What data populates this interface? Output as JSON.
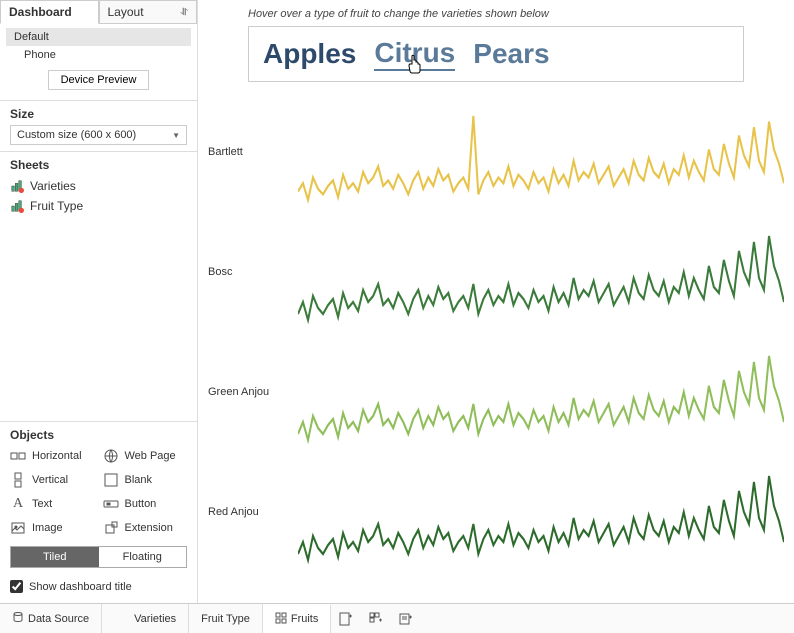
{
  "sidebar": {
    "tabs": {
      "dashboard": "Dashboard",
      "layout": "Layout"
    },
    "devices": {
      "default": "Default",
      "phone": "Phone",
      "preview_btn": "Device Preview"
    },
    "size": {
      "title": "Size",
      "value": "Custom size (600 x 600)"
    },
    "sheets": {
      "title": "Sheets",
      "items": [
        "Varieties",
        "Fruit Type"
      ]
    },
    "objects": {
      "title": "Objects",
      "items": {
        "horizontal": "Horizontal",
        "webpage": "Web Page",
        "vertical": "Vertical",
        "blank": "Blank",
        "text": "Text",
        "button": "Button",
        "image": "Image",
        "extension": "Extension"
      }
    },
    "toggle": {
      "tiled": "Tiled",
      "floating": "Floating"
    },
    "show_title": "Show dashboard title"
  },
  "canvas": {
    "hint": "Hover over a type of fruit to change the varieties shown below",
    "fruits": {
      "apples": "Apples",
      "citrus": "Citrus",
      "pears": "Pears"
    },
    "colors": {
      "apples": "#2d4a6b",
      "citrus": "#5b7a99",
      "pears": "#5b7a99"
    }
  },
  "bottom": {
    "data_source": "Data Source",
    "tabs": [
      "Varieties",
      "Fruit Type",
      "Fruits"
    ]
  },
  "chart_data": [
    {
      "type": "line",
      "label": "Bartlett",
      "color": "#e8c34a",
      "values": [
        45,
        48,
        42,
        50,
        46,
        44,
        47,
        49,
        43,
        51,
        46,
        48,
        45,
        52,
        48,
        50,
        54,
        47,
        49,
        46,
        51,
        48,
        44,
        49,
        52,
        46,
        50,
        47,
        53,
        49,
        51,
        45,
        48,
        50,
        46,
        72,
        44,
        49,
        52,
        47,
        50,
        48,
        54,
        47,
        51,
        49,
        46,
        52,
        48,
        50,
        45,
        53,
        48,
        51,
        47,
        56,
        49,
        52,
        50,
        55,
        48,
        51,
        54,
        47,
        50,
        53,
        48,
        56,
        51,
        49,
        57,
        52,
        50,
        55,
        48,
        53,
        51,
        58,
        50,
        56,
        52,
        49,
        60,
        53,
        51,
        62,
        55,
        50,
        65,
        58,
        54,
        68,
        56,
        52,
        70,
        60,
        55,
        48
      ]
    },
    {
      "type": "line",
      "label": "Bosc",
      "color": "#3a7a3a",
      "values": [
        42,
        46,
        40,
        48,
        44,
        42,
        45,
        47,
        41,
        49,
        44,
        46,
        43,
        50,
        46,
        48,
        52,
        45,
        47,
        44,
        49,
        46,
        42,
        47,
        50,
        44,
        48,
        45,
        51,
        47,
        49,
        43,
        46,
        48,
        44,
        52,
        42,
        47,
        50,
        45,
        48,
        46,
        52,
        45,
        49,
        47,
        44,
        50,
        46,
        48,
        43,
        51,
        46,
        49,
        45,
        54,
        47,
        50,
        48,
        53,
        46,
        49,
        52,
        45,
        48,
        51,
        46,
        54,
        49,
        47,
        55,
        50,
        48,
        53,
        46,
        51,
        49,
        56,
        48,
        54,
        50,
        47,
        58,
        51,
        49,
        60,
        53,
        48,
        63,
        56,
        52,
        66,
        54,
        50,
        68,
        58,
        53,
        46
      ]
    },
    {
      "type": "line",
      "label": "Green Anjou",
      "color": "#8fbe5a",
      "values": [
        40,
        44,
        38,
        46,
        42,
        40,
        43,
        45,
        39,
        47,
        42,
        44,
        41,
        48,
        44,
        46,
        50,
        43,
        45,
        42,
        47,
        44,
        40,
        45,
        48,
        42,
        46,
        43,
        49,
        45,
        47,
        41,
        44,
        46,
        42,
        50,
        40,
        45,
        48,
        43,
        46,
        44,
        50,
        43,
        47,
        45,
        42,
        48,
        44,
        46,
        41,
        49,
        44,
        47,
        43,
        52,
        45,
        48,
        46,
        51,
        44,
        47,
        50,
        43,
        46,
        49,
        44,
        52,
        47,
        45,
        53,
        48,
        46,
        51,
        44,
        49,
        47,
        54,
        46,
        52,
        48,
        45,
        56,
        49,
        47,
        58,
        51,
        46,
        61,
        54,
        50,
        64,
        52,
        48,
        66,
        56,
        51,
        44
      ]
    },
    {
      "type": "line",
      "label": "Red Anjou",
      "color": "#2d6b2d",
      "values": [
        38,
        42,
        36,
        44,
        40,
        38,
        41,
        43,
        37,
        45,
        40,
        42,
        39,
        46,
        42,
        44,
        48,
        41,
        43,
        40,
        45,
        42,
        38,
        43,
        46,
        40,
        44,
        41,
        47,
        43,
        45,
        39,
        42,
        44,
        40,
        48,
        38,
        43,
        46,
        41,
        44,
        42,
        48,
        41,
        45,
        43,
        40,
        46,
        42,
        44,
        39,
        47,
        42,
        45,
        41,
        50,
        43,
        46,
        44,
        49,
        42,
        45,
        48,
        41,
        44,
        47,
        42,
        50,
        45,
        43,
        51,
        46,
        44,
        49,
        42,
        47,
        45,
        52,
        44,
        50,
        46,
        43,
        54,
        47,
        45,
        56,
        49,
        44,
        59,
        52,
        48,
        62,
        50,
        46,
        64,
        54,
        49,
        42
      ]
    }
  ]
}
